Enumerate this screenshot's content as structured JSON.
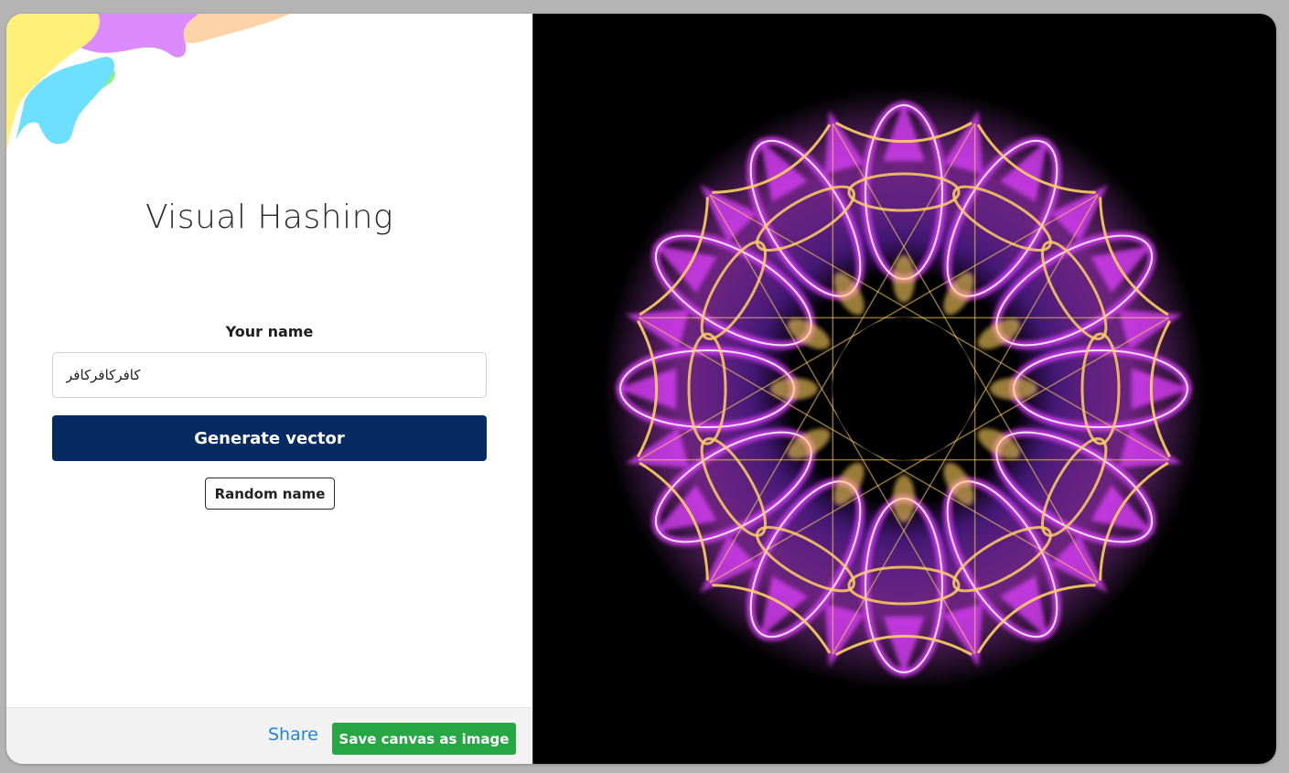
{
  "app": {
    "title": "Visual Hashing"
  },
  "form": {
    "name_label": "Your name",
    "name_value": "كافركافركافر",
    "generate_label": "Generate vector",
    "random_label": "Random name"
  },
  "footer": {
    "share_label": "Share",
    "save_label": "Save canvas as image"
  },
  "colors": {
    "primary": "#052b62",
    "success": "#27a744",
    "link": "#1f86d6",
    "canvas_bg": "#000000",
    "pattern_pink": "#e040ff",
    "pattern_gold": "#ffd060",
    "pattern_purple": "#6a2fc0"
  }
}
